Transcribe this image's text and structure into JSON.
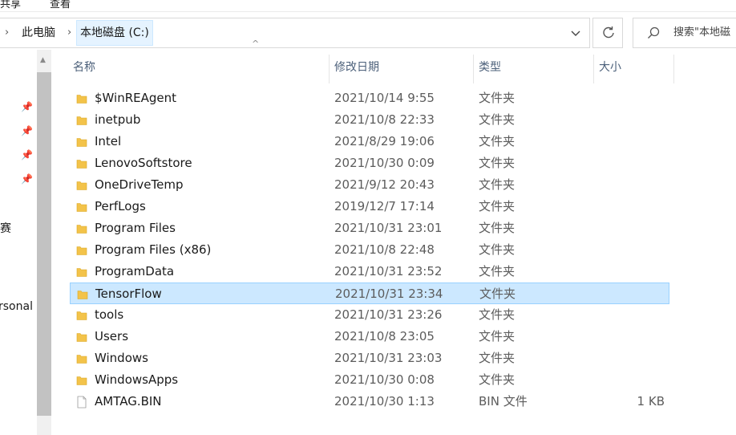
{
  "ribbon": {
    "share_label": "共享",
    "view_label": "查看"
  },
  "address_bar": {
    "crumbs": [
      "此电脑",
      "本地磁盘 (C:)"
    ]
  },
  "search": {
    "placeholder": "搜索\"本地磁"
  },
  "nav_pane": {
    "items": [
      "赛",
      "rsonal"
    ]
  },
  "columns": {
    "name": "名称",
    "date": "修改日期",
    "type": "类型",
    "size": "大小"
  },
  "colors": {
    "folder": "#f3c34a",
    "selection_fill": "#cce8ff",
    "selection_border": "#99d1ff"
  },
  "files": [
    {
      "name": "$WinREAgent",
      "date": "2021/10/14 9:55",
      "type": "文件夹",
      "size": "",
      "icon": "folder-icon"
    },
    {
      "name": "inetpub",
      "date": "2021/10/8 22:33",
      "type": "文件夹",
      "size": "",
      "icon": "folder-icon"
    },
    {
      "name": "Intel",
      "date": "2021/8/29 19:06",
      "type": "文件夹",
      "size": "",
      "icon": "folder-icon"
    },
    {
      "name": "LenovoSoftstore",
      "date": "2021/10/30 0:09",
      "type": "文件夹",
      "size": "",
      "icon": "folder-icon"
    },
    {
      "name": "OneDriveTemp",
      "date": "2021/9/12 20:43",
      "type": "文件夹",
      "size": "",
      "icon": "folder-icon"
    },
    {
      "name": "PerfLogs",
      "date": "2019/12/7 17:14",
      "type": "文件夹",
      "size": "",
      "icon": "folder-icon"
    },
    {
      "name": "Program Files",
      "date": "2021/10/31 23:01",
      "type": "文件夹",
      "size": "",
      "icon": "folder-icon"
    },
    {
      "name": "Program Files (x86)",
      "date": "2021/10/8 22:48",
      "type": "文件夹",
      "size": "",
      "icon": "folder-icon"
    },
    {
      "name": "ProgramData",
      "date": "2021/10/31 23:52",
      "type": "文件夹",
      "size": "",
      "icon": "folder-icon"
    },
    {
      "name": "TensorFlow",
      "date": "2021/10/31 23:34",
      "type": "文件夹",
      "size": "",
      "icon": "folder-icon",
      "selected": true
    },
    {
      "name": "tools",
      "date": "2021/10/31 23:26",
      "type": "文件夹",
      "size": "",
      "icon": "folder-icon"
    },
    {
      "name": "Users",
      "date": "2021/10/8 23:05",
      "type": "文件夹",
      "size": "",
      "icon": "folder-icon"
    },
    {
      "name": "Windows",
      "date": "2021/10/31 23:03",
      "type": "文件夹",
      "size": "",
      "icon": "folder-icon"
    },
    {
      "name": "WindowsApps",
      "date": "2021/10/30 0:08",
      "type": "文件夹",
      "size": "",
      "icon": "folder-icon"
    },
    {
      "name": "AMTAG.BIN",
      "date": "2021/10/30 1:13",
      "type": "BIN 文件",
      "size": "1 KB",
      "icon": "file-icon"
    }
  ]
}
